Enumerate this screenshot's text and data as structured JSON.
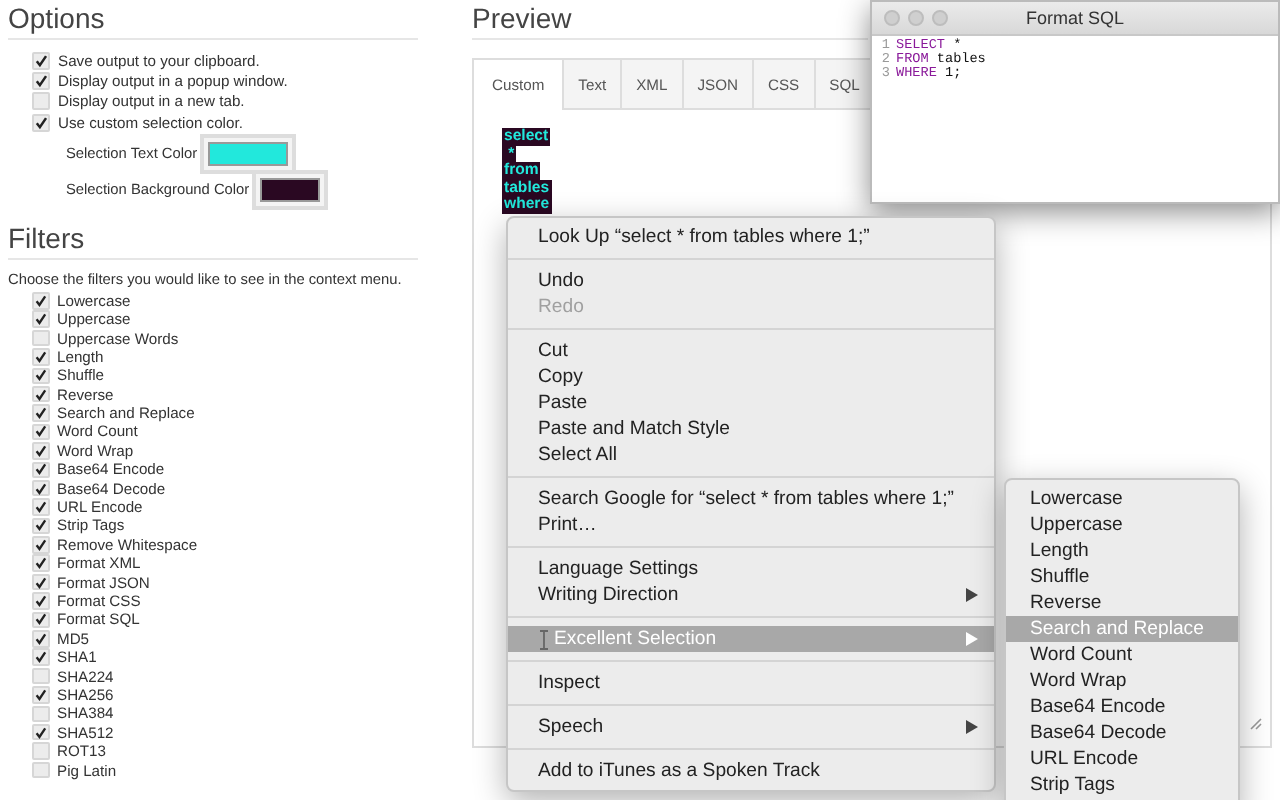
{
  "options": {
    "title": "Options",
    "items": [
      {
        "label": "Save output to your clipboard.",
        "checked": true
      },
      {
        "label": "Display output in a popup window.",
        "checked": true
      },
      {
        "label": "Display output in a new tab.",
        "checked": false
      },
      {
        "label": "Use custom selection color.",
        "checked": true
      }
    ],
    "colors": [
      {
        "label": "Selection Text Color",
        "color": "#22e8dc"
      },
      {
        "label": "Selection Background Color",
        "color": "#2a0822"
      }
    ]
  },
  "filters": {
    "title": "Filters",
    "description": "Choose the filters you would like to see in the context menu.",
    "items": [
      {
        "label": "Lowercase",
        "checked": true
      },
      {
        "label": "Uppercase",
        "checked": true
      },
      {
        "label": "Uppercase Words",
        "checked": false
      },
      {
        "label": "Length",
        "checked": true
      },
      {
        "label": "Shuffle",
        "checked": true
      },
      {
        "label": "Reverse",
        "checked": true
      },
      {
        "label": "Search and Replace",
        "checked": true
      },
      {
        "label": "Word Count",
        "checked": true
      },
      {
        "label": "Word Wrap",
        "checked": true
      },
      {
        "label": "Base64 Encode",
        "checked": true
      },
      {
        "label": "Base64 Decode",
        "checked": true
      },
      {
        "label": "URL Encode",
        "checked": true
      },
      {
        "label": "Strip Tags",
        "checked": true
      },
      {
        "label": "Remove Whitespace",
        "checked": true
      },
      {
        "label": "Format XML",
        "checked": true
      },
      {
        "label": "Format JSON",
        "checked": true
      },
      {
        "label": "Format CSS",
        "checked": true
      },
      {
        "label": "Format SQL",
        "checked": true
      },
      {
        "label": "MD5",
        "checked": true
      },
      {
        "label": "SHA1",
        "checked": true
      },
      {
        "label": "SHA224",
        "checked": false
      },
      {
        "label": "SHA256",
        "checked": true
      },
      {
        "label": "SHA384",
        "checked": false
      },
      {
        "label": "SHA512",
        "checked": true
      },
      {
        "label": "ROT13",
        "checked": false
      },
      {
        "label": "Pig Latin",
        "checked": false
      }
    ]
  },
  "preview": {
    "title": "Preview",
    "tabs": [
      {
        "label": "Custom",
        "selected": true
      },
      {
        "label": "Text",
        "selected": false
      },
      {
        "label": "XML",
        "selected": false
      },
      {
        "label": "JSON",
        "selected": false
      },
      {
        "label": "CSS",
        "selected": false
      },
      {
        "label": "SQL",
        "selected": false
      }
    ],
    "selected_lines": [
      "select",
      " *",
      "from",
      "tables",
      "where"
    ]
  },
  "popup_window": {
    "title": "Format SQL",
    "code_lines": [
      {
        "number": "1",
        "tokens": [
          {
            "text": "SELECT",
            "kind": "keyword"
          },
          {
            "text": " *",
            "kind": "plain"
          }
        ]
      },
      {
        "number": "2",
        "tokens": [
          {
            "text": "FROM",
            "kind": "keyword"
          },
          {
            "text": " tables",
            "kind": "plain"
          }
        ]
      },
      {
        "number": "3",
        "tokens": [
          {
            "text": "WHERE",
            "kind": "keyword"
          },
          {
            "text": " 1;",
            "kind": "plain"
          }
        ]
      }
    ]
  },
  "context_menu": {
    "items": [
      {
        "kind": "item",
        "label": "Look Up “select  * from tables where 1;”",
        "disabled": false,
        "selected": false,
        "has_submenu": false
      },
      {
        "kind": "separator"
      },
      {
        "kind": "item",
        "label": "Undo",
        "disabled": false,
        "selected": false,
        "has_submenu": false
      },
      {
        "kind": "item",
        "label": "Redo",
        "disabled": true,
        "selected": false,
        "has_submenu": false
      },
      {
        "kind": "separator"
      },
      {
        "kind": "item",
        "label": "Cut",
        "disabled": false,
        "selected": false,
        "has_submenu": false
      },
      {
        "kind": "item",
        "label": "Copy",
        "disabled": false,
        "selected": false,
        "has_submenu": false
      },
      {
        "kind": "item",
        "label": "Paste",
        "disabled": false,
        "selected": false,
        "has_submenu": false
      },
      {
        "kind": "item",
        "label": "Paste and Match Style",
        "disabled": false,
        "selected": false,
        "has_submenu": false
      },
      {
        "kind": "item",
        "label": "Select All",
        "disabled": false,
        "selected": false,
        "has_submenu": false
      },
      {
        "kind": "separator"
      },
      {
        "kind": "item",
        "label": "Search Google for “select  * from tables where 1;”",
        "disabled": false,
        "selected": false,
        "has_submenu": false
      },
      {
        "kind": "item",
        "label": "Print…",
        "disabled": false,
        "selected": false,
        "has_submenu": false
      },
      {
        "kind": "separator"
      },
      {
        "kind": "item",
        "label": "Language Settings",
        "disabled": false,
        "selected": false,
        "has_submenu": false
      },
      {
        "kind": "item",
        "label": "Writing Direction",
        "disabled": false,
        "selected": false,
        "has_submenu": true
      },
      {
        "kind": "separator"
      },
      {
        "kind": "item",
        "label": "Excellent Selection",
        "disabled": false,
        "selected": true,
        "has_submenu": true
      },
      {
        "kind": "separator"
      },
      {
        "kind": "item",
        "label": "Inspect",
        "disabled": false,
        "selected": false,
        "has_submenu": false
      },
      {
        "kind": "separator"
      },
      {
        "kind": "item",
        "label": "Speech",
        "disabled": false,
        "selected": false,
        "has_submenu": true
      },
      {
        "kind": "separator"
      },
      {
        "kind": "item",
        "label": "Add to iTunes as a Spoken Track",
        "disabled": false,
        "selected": false,
        "has_submenu": false
      }
    ]
  },
  "submenu": {
    "items": [
      {
        "label": "Lowercase",
        "selected": false
      },
      {
        "label": "Uppercase",
        "selected": false
      },
      {
        "label": "Length",
        "selected": false
      },
      {
        "label": "Shuffle",
        "selected": false
      },
      {
        "label": "Reverse",
        "selected": false
      },
      {
        "label": "Search and Replace",
        "selected": true
      },
      {
        "label": "Word Count",
        "selected": false
      },
      {
        "label": "Word Wrap",
        "selected": false
      },
      {
        "label": "Base64 Encode",
        "selected": false
      },
      {
        "label": "Base64 Decode",
        "selected": false
      },
      {
        "label": "URL Encode",
        "selected": false
      },
      {
        "label": "Strip Tags",
        "selected": false
      }
    ]
  }
}
